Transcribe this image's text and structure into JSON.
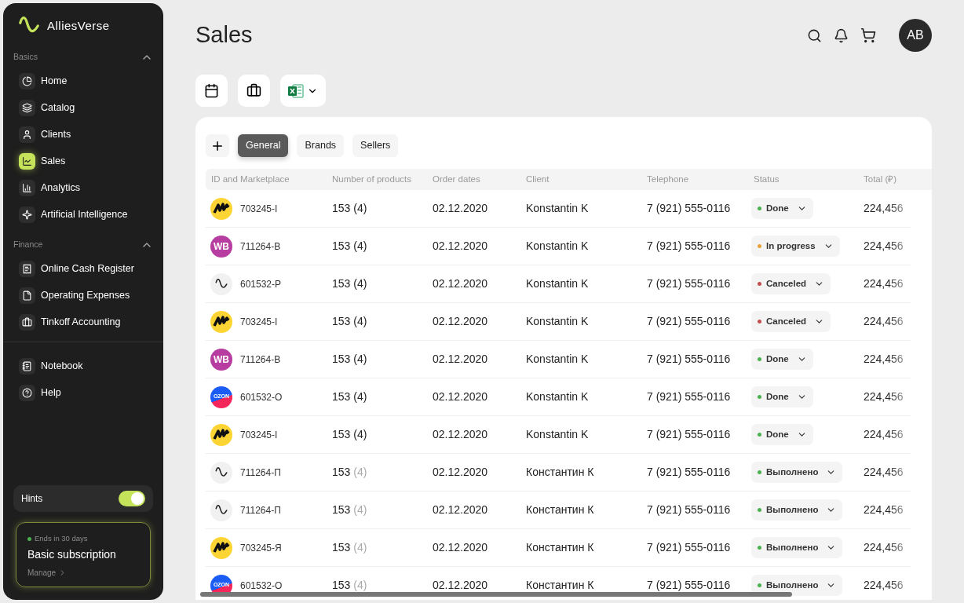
{
  "sidebar": {
    "brand": "AlliesVerse",
    "sections": [
      {
        "title": "Basics",
        "expanded": true,
        "items": [
          {
            "label": "Home",
            "selected": false
          },
          {
            "label": "Catalog",
            "selected": false
          },
          {
            "label": "Clients",
            "selected": false
          },
          {
            "label": "Sales",
            "selected": true
          },
          {
            "label": "Analytics",
            "selected": false
          },
          {
            "label": "Artificial Intelligence",
            "selected": false
          }
        ]
      },
      {
        "title": "Finance",
        "expanded": true,
        "items": [
          {
            "label": "Online Cash Register",
            "selected": false
          },
          {
            "label": "Operating Expenses",
            "selected": false
          },
          {
            "label": "Tinkoff Accounting",
            "selected": false
          }
        ]
      }
    ],
    "extra_items": [
      {
        "label": "Notebook",
        "selected": false
      },
      {
        "label": "Help",
        "selected": false
      }
    ],
    "hints": {
      "label": "Hints",
      "on": true
    },
    "subscription": {
      "status": "Ends in 30 days",
      "title": "Basic subscription",
      "link": "Manage"
    }
  },
  "header": {
    "title": "Sales",
    "avatar": "AB"
  },
  "tabs": [
    {
      "label": "General",
      "selected": true
    },
    {
      "label": "Brands",
      "selected": false
    },
    {
      "label": "Sellers",
      "selected": false
    }
  ],
  "table": {
    "columns": [
      "ID and Marketplace",
      "Number of products",
      "Order dates",
      "Client",
      "Telephone",
      "Status",
      "Total (₽)"
    ],
    "rows": [
      {
        "kind": "yandex",
        "id": "703245-I",
        "count": "153",
        "variants": "(4)",
        "variants_muted": false,
        "date": "02.12.2020",
        "client": "Konstantin K",
        "phone": "7 (921) 555-0116",
        "status": "Done",
        "color": "#4caf50",
        "total": "224,456"
      },
      {
        "kind": "wb",
        "logo_label": "WB",
        "id": "711264-B",
        "count": "153",
        "variants": "(4)",
        "variants_muted": false,
        "date": "02.12.2020",
        "client": "Konstantin K",
        "phone": "7 (921) 555-0116",
        "status": "In progress",
        "color": "#e8a23a",
        "total": "224,456"
      },
      {
        "kind": "allies",
        "id": "601532-P",
        "count": "153",
        "variants": "(4)",
        "variants_muted": false,
        "date": "02.12.2020",
        "client": "Konstantin K",
        "phone": "7 (921) 555-0116",
        "status": "Canceled",
        "color": "#c0504d",
        "total": "224,456"
      },
      {
        "kind": "yandex",
        "id": "703245-I",
        "count": "153",
        "variants": "(4)",
        "variants_muted": false,
        "date": "02.12.2020",
        "client": "Konstantin K",
        "phone": "7 (921) 555-0116",
        "status": "Canceled",
        "color": "#c0504d",
        "total": "224,456"
      },
      {
        "kind": "wb",
        "logo_label": "WB",
        "id": "711264-B",
        "count": "153",
        "variants": "(4)",
        "variants_muted": false,
        "date": "02.12.2020",
        "client": "Konstantin K",
        "phone": "7 (921) 555-0116",
        "status": "Done",
        "color": "#4caf50",
        "total": "224,456"
      },
      {
        "kind": "ozon",
        "logo_label": "OZON",
        "id": "601532-O",
        "count": "153",
        "variants": "(4)",
        "variants_muted": false,
        "date": "02.12.2020",
        "client": "Konstantin K",
        "phone": "7 (921) 555-0116",
        "status": "Done",
        "color": "#4caf50",
        "total": "224,456"
      },
      {
        "kind": "yandex",
        "id": "703245-I",
        "count": "153",
        "variants": "(4)",
        "variants_muted": false,
        "date": "02.12.2020",
        "client": "Konstantin K",
        "phone": "7 (921) 555-0116",
        "status": "Done",
        "color": "#4caf50",
        "total": "224,456"
      },
      {
        "kind": "allies",
        "id": "711264-П",
        "count": "153",
        "variants": "(4)",
        "variants_muted": true,
        "date": "02.12.2020",
        "client": "Константин К",
        "phone": "7 (921) 555-0116",
        "status": "Выполнено",
        "color": "#4caf50",
        "total": "224,456"
      },
      {
        "kind": "allies",
        "id": "711264-П",
        "count": "153",
        "variants": "(4)",
        "variants_muted": true,
        "date": "02.12.2020",
        "client": "Константин К",
        "phone": "7 (921) 555-0116",
        "status": "Выполнено",
        "color": "#4caf50",
        "total": "224,456"
      },
      {
        "kind": "yandex",
        "id": "703245-Я",
        "count": "153",
        "variants": "(4)",
        "variants_muted": true,
        "date": "02.12.2020",
        "client": "Константин К",
        "phone": "7 (921) 555-0116",
        "status": "Выполнено",
        "color": "#4caf50",
        "total": "224,456"
      },
      {
        "kind": "ozon",
        "logo_label": "OZON",
        "id": "601532-O",
        "count": "153",
        "variants": "(4)",
        "variants_muted": true,
        "date": "02.12.2020",
        "client": "Константин К",
        "phone": "7 (921) 555-0116",
        "status": "Выполнено",
        "color": "#4caf50",
        "total": "224,456"
      }
    ]
  }
}
